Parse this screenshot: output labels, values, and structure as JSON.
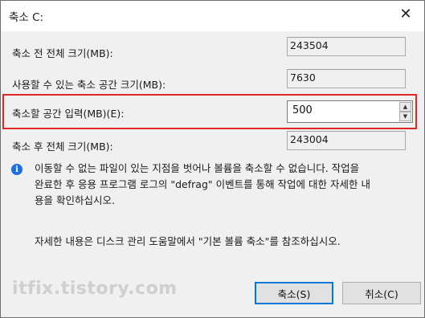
{
  "window": {
    "title": "축소 C:",
    "close_glyph": "✕"
  },
  "rows": {
    "total_before_label": "축소 전 전체 크기(MB):",
    "total_before_value": "243504",
    "available_label": "사용할 수 있는 축소 공간 크기(MB):",
    "available_value": "7630",
    "enter_amount_label": "축소할 공간 입력(MB)(E):",
    "enter_amount_value": "500",
    "total_after_label": "축소 후 전체 크기(MB):",
    "total_after_value": "243004"
  },
  "info": {
    "icon": "info-icon",
    "icon_glyph": "i",
    "line1": "이동할 수 없는 파일이 있는 지점을 벗어나 볼륨을 축소할 수 없습니다. 작업을",
    "line2": "완료한 후 응용 프로그램 로그의 \"defrag\" 이벤트를 통해 작업에 대한 자세한 내",
    "line3": "용을 확인하십시오.",
    "help": "자세한 내용은 디스크 관리 도움말에서 \"기본 볼륨 축소\"를 참조하십시오."
  },
  "buttons": {
    "shrink": "축소(S)",
    "cancel": "취소(C)"
  },
  "watermark": "itfix.tistory.com",
  "colors": {
    "highlight": "#e02626",
    "accent": "#0078d7",
    "info_icon": "#1d6fe0"
  }
}
